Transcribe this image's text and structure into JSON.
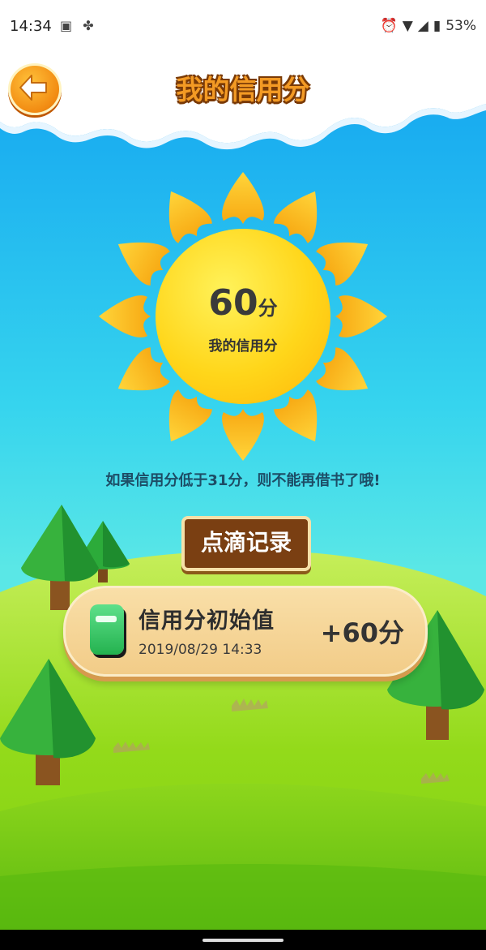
{
  "status_bar": {
    "time": "14:34",
    "left_icons": [
      "image-icon",
      "leaf-icon"
    ],
    "right_icons": [
      "alarm-icon",
      "wifi-icon",
      "signal-icon",
      "battery-icon"
    ],
    "battery": "53%"
  },
  "header": {
    "title": "我的信用分"
  },
  "score": {
    "value": "60",
    "unit": "分",
    "label": "我的信用分"
  },
  "warning_text": "如果信用分低于31分，则不能再借书了哦!",
  "records_sign": "点滴记录",
  "records": [
    {
      "title": "信用分初始值",
      "date": "2019/08/29 14:33",
      "points": "+60分"
    }
  ],
  "colors": {
    "sky_top": "#0f9df0",
    "sky_bottom": "#63e8e3",
    "sun": "#ffd61a",
    "title_fill": "#f39a24",
    "title_outline": "#7a3a06",
    "card_bg": "#f2cc88",
    "grass": "#8fd822"
  }
}
